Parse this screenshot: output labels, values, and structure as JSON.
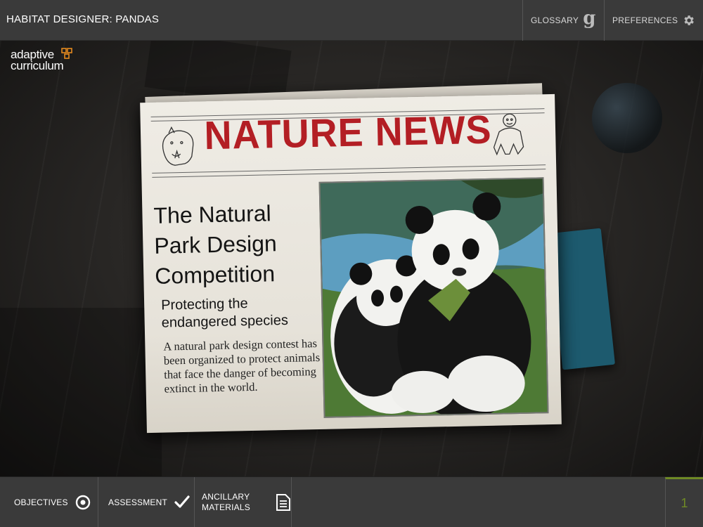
{
  "header": {
    "title": "HABITAT DESIGNER: PANDAS",
    "glossary_label": "GLOSSARY",
    "preferences_label": "PREFERENCES"
  },
  "logo": {
    "line1": "adaptive",
    "line2": "curriculum"
  },
  "newspaper": {
    "masthead": "NATURE NEWS",
    "headline": "The Natural Park Design Competition",
    "subhead": "Protecting the endangered species",
    "body": "A natural park design contest has been organized to protect animals that face the danger of becoming extinct in the world."
  },
  "footer": {
    "objectives_label": "OBJECTIVES",
    "assessment_label": "ASSESSMENT",
    "ancillary_label_line1": "ANCILLARY",
    "ancillary_label_line2": "MATERIALS",
    "page_number": "1"
  },
  "colors": {
    "bar_bg": "#3a3a3a",
    "masthead_red": "#b31e24",
    "accent_green": "#6f8a25",
    "logo_orange": "#e58a1f"
  },
  "icons": [
    "glossary-g-icon",
    "gear-icon",
    "target-icon",
    "checkmark-icon",
    "document-icon",
    "rhino-icon",
    "gorilla-icon",
    "logo-mark-icon"
  ]
}
